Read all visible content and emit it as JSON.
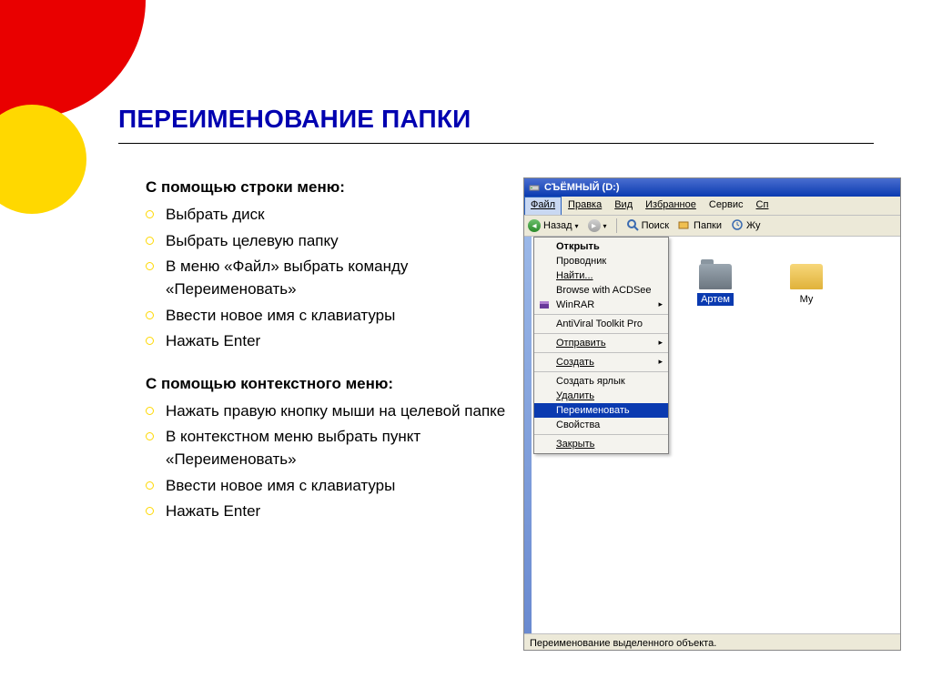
{
  "title": "ПЕРЕИМЕНОВАНИЕ ПАПКИ",
  "section1_heading": "С помощью строки меню:",
  "section1_items": [
    "Выбрать диск",
    "Выбрать целевую папку",
    "В меню «Файл» выбрать команду «Переименовать»",
    "Ввести новое имя с клавиатуры",
    "Нажать Enter"
  ],
  "section2_heading": "С помощью контекстного меню:",
  "section2_items": [
    "Нажать правую кнопку мыши на целевой папке",
    "В контекстном меню выбрать пункт «Переименовать»",
    "Ввести новое имя с клавиатуры",
    "Нажать Enter"
  ],
  "win": {
    "title": "СЪЁМНЫЙ (D:)",
    "menubar": [
      "Файл",
      "Правка",
      "Вид",
      "Избранное",
      "Сервис",
      "Сп"
    ],
    "toolbar": {
      "back": "Назад",
      "search": "Поиск",
      "folders": "Папки",
      "journal": "Жу"
    },
    "dropdown": {
      "g1": [
        {
          "label": "Открыть",
          "bold": true
        },
        {
          "label": "Проводник"
        },
        {
          "label": "Найти...",
          "u": true
        },
        {
          "label": "Browse with ACDSee"
        },
        {
          "label": "WinRAR",
          "sub": true,
          "icon": "winrar"
        }
      ],
      "g2": [
        {
          "label": "AntiViral Toolkit Pro"
        }
      ],
      "g3": [
        {
          "label": "Отправить",
          "sub": true,
          "u": true
        }
      ],
      "g4": [
        {
          "label": "Создать",
          "sub": true,
          "u": true
        }
      ],
      "g5": [
        {
          "label": "Создать ярлык"
        },
        {
          "label": "Удалить",
          "u": true
        },
        {
          "label": "Переименовать",
          "sel": true,
          "u": true
        },
        {
          "label": "Свойства"
        }
      ],
      "g6": [
        {
          "label": "Закрыть",
          "u": true
        }
      ]
    },
    "folders": [
      {
        "name": "Артем",
        "sel": true,
        "color": "gray"
      },
      {
        "name": "Му",
        "sel": false,
        "color": "yellow"
      }
    ],
    "status": "Переименование выделенного объекта."
  }
}
